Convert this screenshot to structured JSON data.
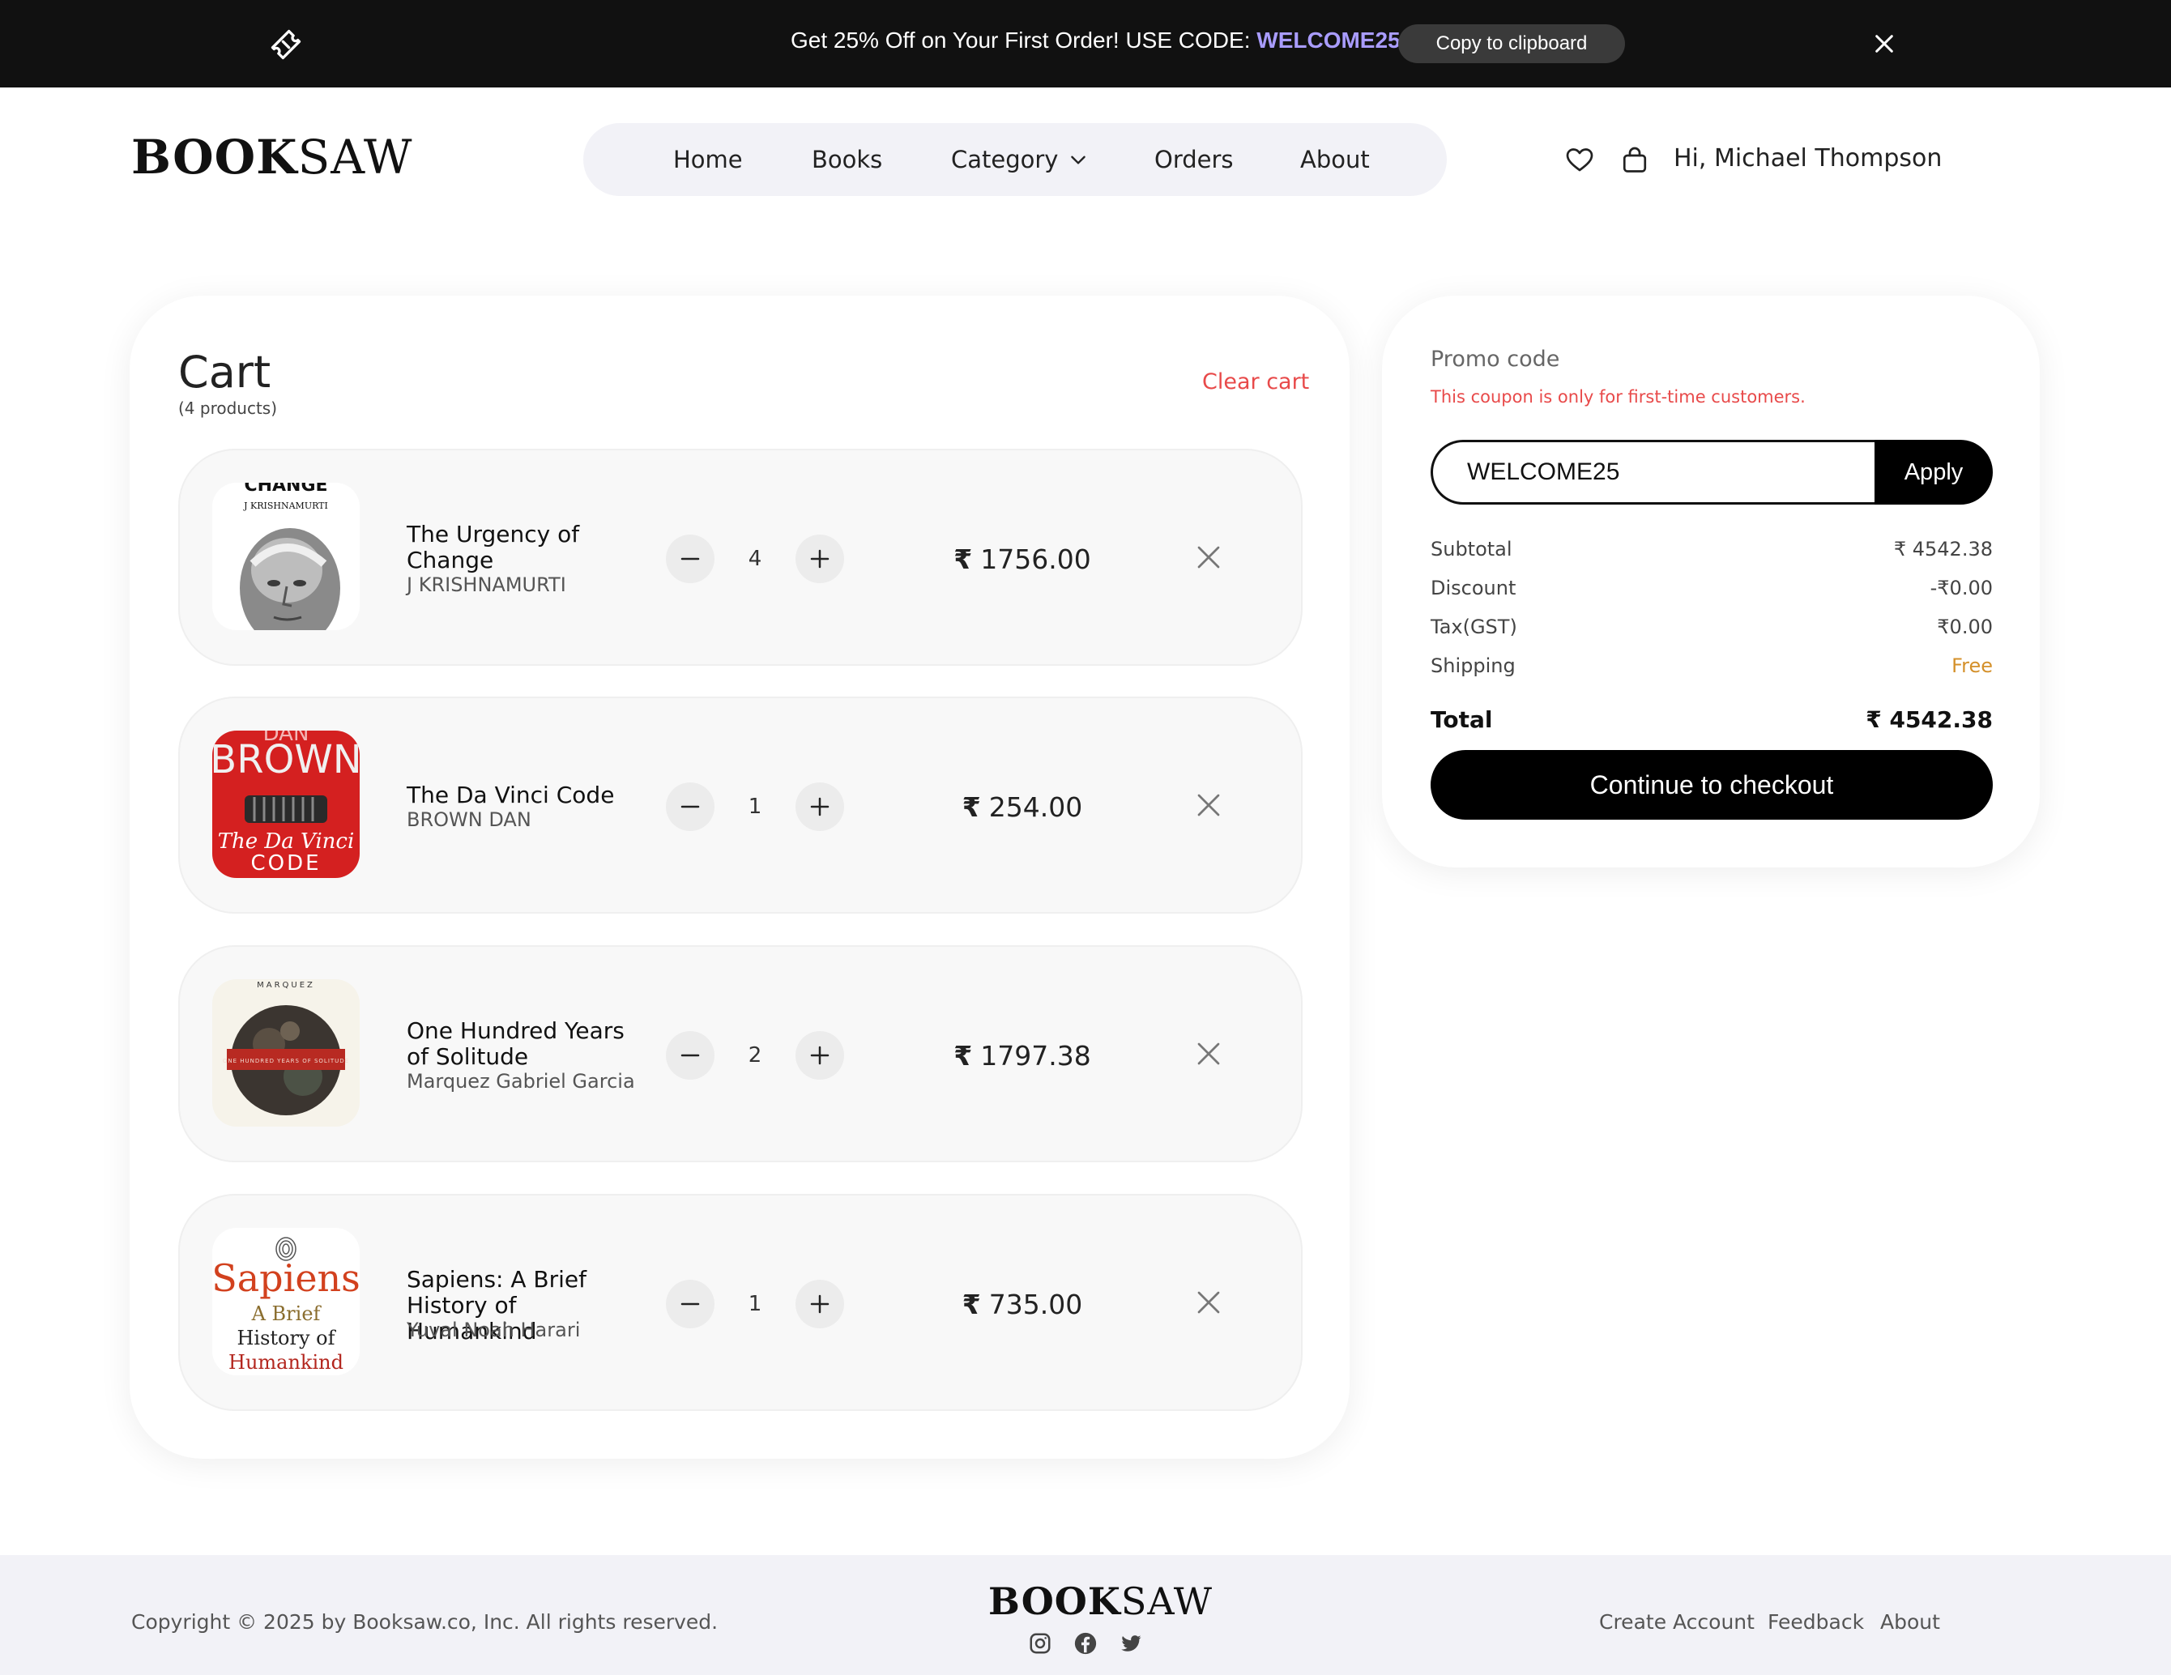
{
  "announcement": {
    "message": "Get 25% Off on Your First Order! USE CODE: ",
    "code": "WELCOME25",
    "copy_button": "Copy to clipboard"
  },
  "brand": {
    "logo_bold": "BOOK",
    "logo_light": "SAW"
  },
  "nav": {
    "items": [
      "Home",
      "Books",
      "Category",
      "Orders",
      "About"
    ]
  },
  "user": {
    "greeting": "Hi, Michael Thompson"
  },
  "cart": {
    "title": "Cart",
    "count": "(4 products)",
    "clear_label": "Clear cart",
    "currency": "₹",
    "items": [
      {
        "title": "The Urgency of Change",
        "author": "J KRISHNAMURTI",
        "quantity": "4",
        "price": "1756.00",
        "cover": {
          "top_text": "CHANGE",
          "sub_text": "J KRISHNAMURTI"
        }
      },
      {
        "title": "The Da Vinci Code",
        "author": "BROWN DAN",
        "quantity": "1",
        "price": "254.00",
        "cover": {
          "top_text": "DAN",
          "main_text": "BROWN",
          "script_text": "The Da Vinci",
          "bottom_text": "CODE"
        }
      },
      {
        "title": "One Hundred Years of Solitude",
        "author": "Marquez Gabriel Garcia",
        "quantity": "2",
        "price": "1797.38",
        "cover": {
          "top_text": "MARQUEZ",
          "band_text": "ONE HUNDRED YEARS OF SOLITUDE"
        }
      },
      {
        "title": "Sapiens: A Brief History of Humankind",
        "author": "Yuval Noah Harari",
        "quantity": "1",
        "price": "735.00",
        "cover": {
          "line1": "Sapiens",
          "line2": "A Brief",
          "line3": "History of",
          "line4": "Humankind"
        }
      }
    ]
  },
  "summary": {
    "promo_label": "Promo code",
    "promo_note": "This coupon is only for first-time customers.",
    "promo_value": "WELCOME25",
    "apply_label": "Apply",
    "rows": [
      {
        "label": "Subtotal",
        "value": "₹ 4542.38"
      },
      {
        "label": "Discount",
        "value": "-₹0.00"
      },
      {
        "label": "Tax(GST)",
        "value": "₹0.00"
      },
      {
        "label": "Shipping",
        "value": "Free"
      }
    ],
    "total_label": "Total",
    "total_value": "₹ 4542.38",
    "checkout_label": "Continue to checkout"
  },
  "footer": {
    "copyright": "Copyright © 2025 by Booksaw.co, Inc. All rights reserved.",
    "links": [
      "Create Account",
      "Feedback",
      "About"
    ],
    "social_icons": [
      "instagram-icon",
      "facebook-icon",
      "twitter-icon"
    ]
  },
  "colors": {
    "accent_code": "#a99cff",
    "danger": "#e84a4a",
    "free": "#d4902a",
    "primary_button": "#000000"
  }
}
